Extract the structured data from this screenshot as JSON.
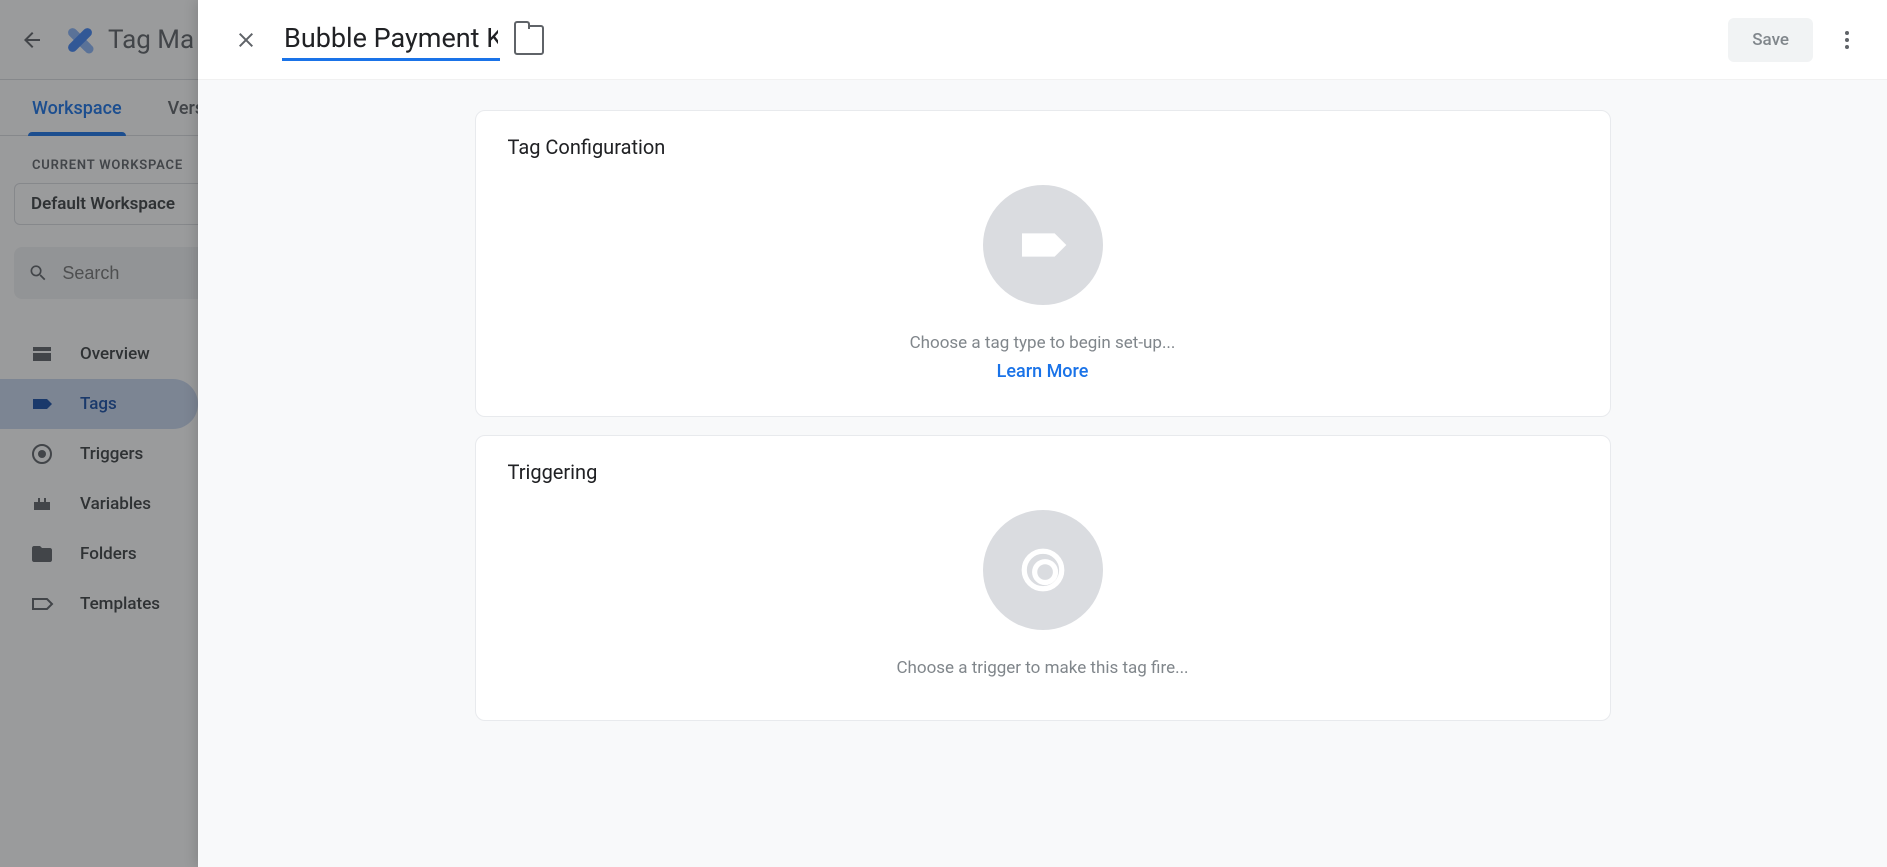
{
  "app": {
    "title": "Tag Ma"
  },
  "tabs": {
    "workspace": "Workspace",
    "versions": "Vers"
  },
  "workspace": {
    "current_label": "CURRENT WORKSPACE",
    "name": "Default Workspace"
  },
  "search": {
    "placeholder": "Search"
  },
  "nav": {
    "overview": "Overview",
    "tags": "Tags",
    "triggers": "Triggers",
    "variables": "Variables",
    "folders": "Folders",
    "templates": "Templates"
  },
  "panel": {
    "title": "Bubble Payment Kit",
    "save": "Save"
  },
  "cards": {
    "tag_config": {
      "title": "Tag Configuration",
      "hint": "Choose a tag type to begin set-up...",
      "learn": "Learn More"
    },
    "triggering": {
      "title": "Triggering",
      "hint": "Choose a trigger to make this tag fire..."
    }
  }
}
